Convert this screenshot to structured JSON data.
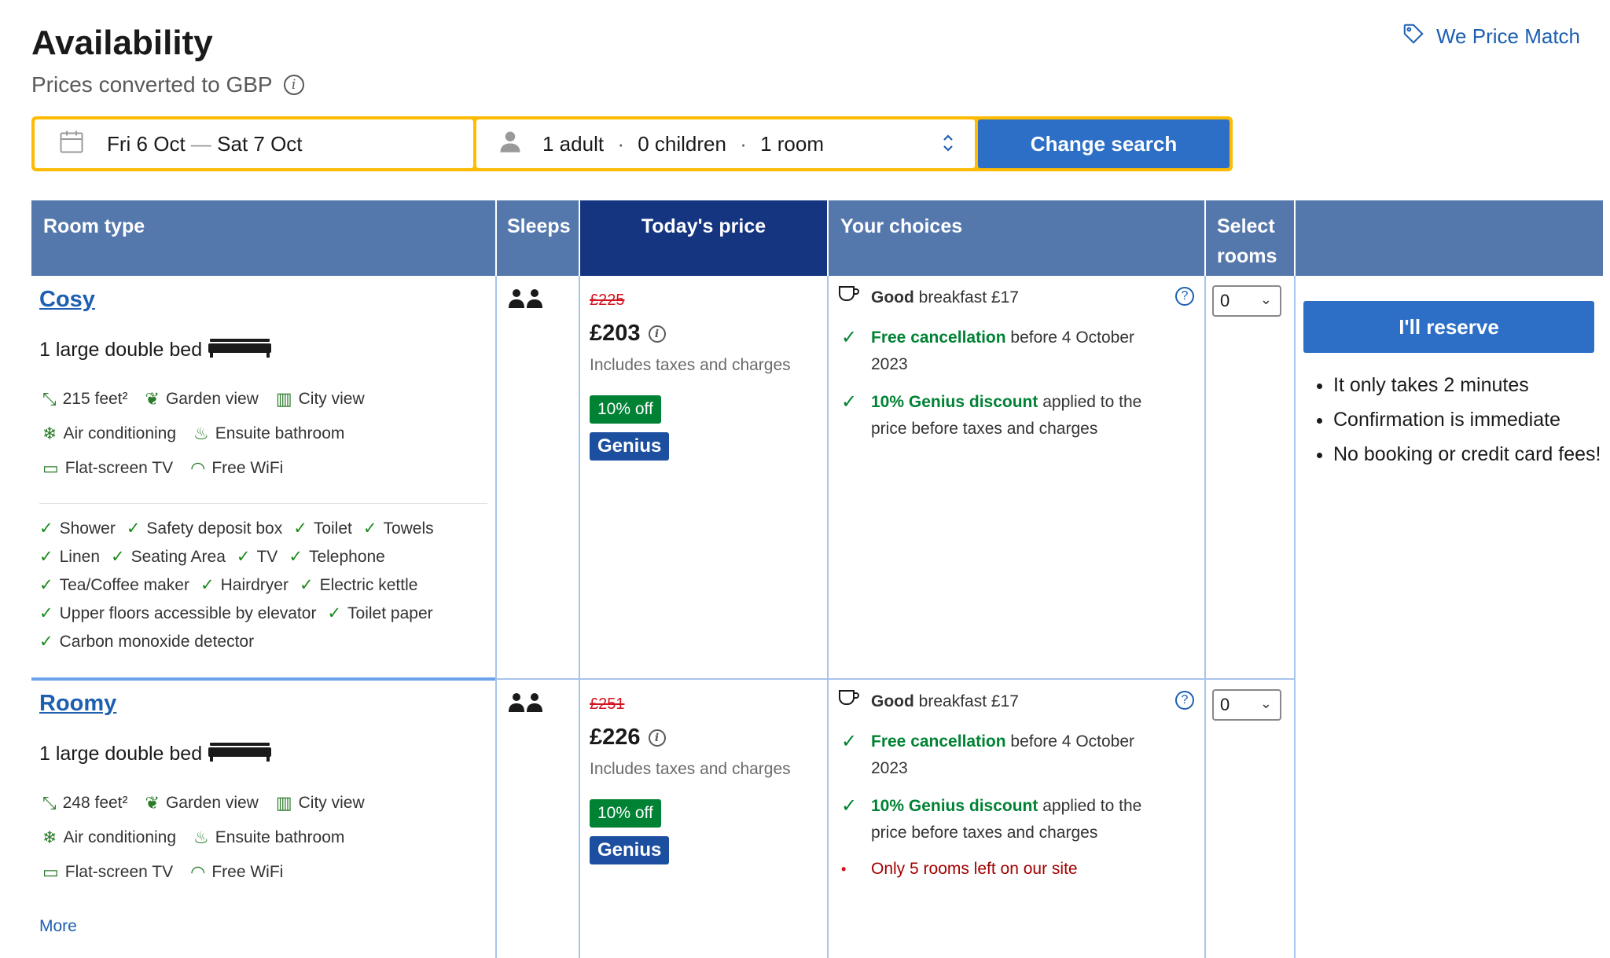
{
  "header": {
    "title": "Availability",
    "subtitle": "Prices converted to GBP",
    "price_match": "We Price Match"
  },
  "search": {
    "dates_from": "Fri 6 Oct",
    "dates_sep": "—",
    "dates_to": "Sat 7 Oct",
    "adults": "1 adult",
    "children": "0 children",
    "rooms": "1 room",
    "dot": "·",
    "button": "Change search"
  },
  "table": {
    "headers": {
      "room_type": "Room type",
      "sleeps": "Sleeps",
      "price": "Today's price",
      "choices": "Your choices",
      "select": "Select rooms"
    },
    "rooms": [
      {
        "name": "Cosy",
        "bed": "1 large double bed",
        "size": "215 feet²",
        "facilities": [
          "Garden view",
          "City view",
          "Air conditioning",
          "Ensuite bathroom",
          "Flat-screen TV",
          "Free WiFi"
        ],
        "amenities": [
          "Shower",
          "Safety deposit box",
          "Toilet",
          "Towels",
          "Linen",
          "Seating Area",
          "TV",
          "Telephone",
          "Tea/Coffee maker",
          "Hairdryer",
          "Electric kettle",
          "Upper floors accessible by elevator",
          "Toilet paper",
          "Carbon monoxide detector"
        ],
        "old_price": "£225",
        "price": "£203",
        "taxes": "Includes taxes and charges",
        "discount_badge": "10% off",
        "genius_badge": "Genius",
        "breakfast_bold": "Good",
        "breakfast_rest": "breakfast £17",
        "cancel_bold": "Free cancellation",
        "cancel_rest": "before 4 October 2023",
        "genius_bold": "10% Genius discount",
        "genius_rest": "applied to the price before taxes and charges",
        "select_value": "0"
      },
      {
        "name": "Roomy",
        "bed": "1 large double bed",
        "size": "248 feet²",
        "facilities": [
          "Garden view",
          "City view",
          "Air conditioning",
          "Ensuite bathroom",
          "Flat-screen TV",
          "Free WiFi"
        ],
        "more": "More",
        "old_price": "£251",
        "price": "£226",
        "taxes": "Includes taxes and charges",
        "discount_badge": "10% off",
        "genius_badge": "Genius",
        "breakfast_bold": "Good",
        "breakfast_rest": "breakfast £17",
        "cancel_bold": "Free cancellation",
        "cancel_rest": "before 4 October 2023",
        "genius_bold": "10% Genius discount",
        "genius_rest": "applied to the price before taxes and charges",
        "scarcity": "Only 5 rooms left on our site",
        "select_value": "0"
      }
    ]
  },
  "reserve": {
    "button": "I'll reserve",
    "bullets": [
      "It only takes 2 minutes",
      "Confirmation is immediate",
      "No booking or credit card fees!"
    ]
  },
  "colors": {
    "header_bg": "#5578ac",
    "price_header_bg": "#163581",
    "button_blue": "#2d6fc6",
    "search_border": "#febb02",
    "green": "#008234",
    "red": "#d4111e"
  },
  "icons": [
    "price-tag-icon",
    "info-icon",
    "calendar-icon",
    "person-icon",
    "sort-arrows-icon",
    "bed-icon",
    "guests-icon",
    "size-icon",
    "garden-icon",
    "city-icon",
    "snowflake-icon",
    "bath-icon",
    "tv-icon",
    "wifi-icon",
    "cup-icon",
    "help-icon",
    "chevron-down-icon"
  ]
}
